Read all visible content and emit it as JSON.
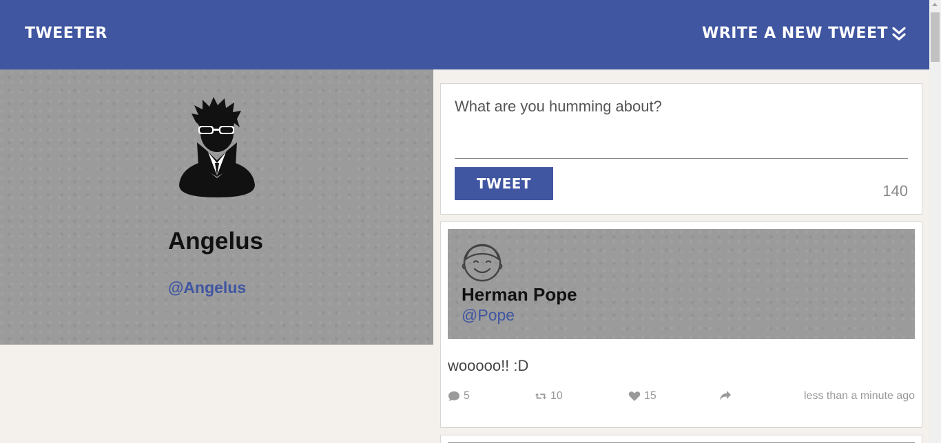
{
  "nav": {
    "brand": "Tweeter",
    "compose_label": "Write a new tweet",
    "compose_icon": "double-chevron-down-icon",
    "background_color": "#4056a1"
  },
  "profile": {
    "name": "Angelus",
    "handle": "@Angelus",
    "avatar_icon": "user-sunglasses-avatar-icon"
  },
  "compose": {
    "placeholder": "What are you humming about?",
    "button_label": "Tweet",
    "counter": "140"
  },
  "tweets": [
    {
      "name": "Herman Pope",
      "handle": "@Pope",
      "avatar_icon": "smiley-face-avatar-icon",
      "content": "wooooo!! :D",
      "comments": "5",
      "retweets": "10",
      "likes": "15",
      "time": "less than a minute ago"
    }
  ],
  "colors": {
    "accent": "#4056a1",
    "page_background": "#f4f1ec",
    "profile_background": "#9b9b9b"
  }
}
